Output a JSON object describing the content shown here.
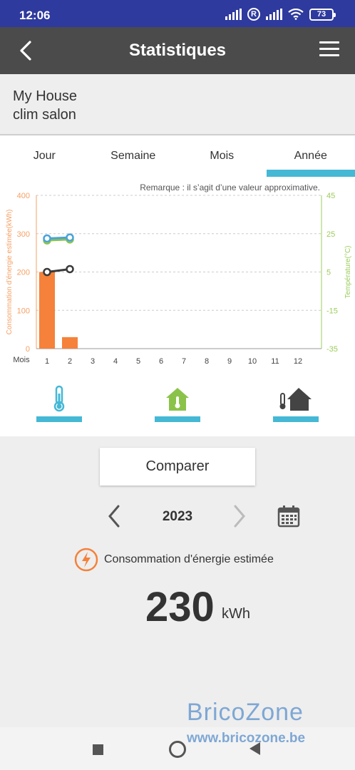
{
  "status": {
    "time": "12:06",
    "battery": "73",
    "roaming": "R"
  },
  "appbar": {
    "title": "Statistiques"
  },
  "device": {
    "home": "My House",
    "name": "clim salon"
  },
  "tabs": [
    {
      "label": "Jour"
    },
    {
      "label": "Semaine"
    },
    {
      "label": "Mois"
    },
    {
      "label": "Année",
      "active": true
    }
  ],
  "chart_data": {
    "type": "bar",
    "note": "Remarque : il s’agit d’une valeur approximative.",
    "xlabel": "Mois",
    "ylabel": "Consommation d’énergie estimée(kWh)",
    "y2label": "Température(°C)",
    "categories": [
      "1",
      "2",
      "3",
      "4",
      "5",
      "6",
      "7",
      "8",
      "9",
      "10",
      "11",
      "12"
    ],
    "ylim": [
      0,
      400
    ],
    "yticks": [
      "0",
      "100",
      "200",
      "300",
      "400"
    ],
    "y2lim": [
      -35,
      45
    ],
    "y2ticks": [
      "-35",
      "-15",
      "5",
      "25",
      "45"
    ],
    "series": [
      {
        "kind": "bar",
        "values": [
          200,
          30
        ],
        "color": "#f5813a"
      },
      {
        "kind": "line",
        "axis": "y2",
        "values": [
          21.5,
          22
        ],
        "color": "#8bc34a"
      },
      {
        "kind": "line",
        "axis": "y2",
        "values": [
          22.5,
          23
        ],
        "color": "#4aa3d9"
      },
      {
        "kind": "line",
        "axis": "y2",
        "values": [
          5,
          6.5
        ],
        "color": "#3a3a3a"
      }
    ],
    "colors": {
      "axis_left": "#f5a064",
      "axis_right": "#9ccc5c",
      "grid": "#cccccc"
    }
  },
  "toggles": [
    {
      "icon": "thermometer-icon"
    },
    {
      "icon": "house-temperature-icon"
    },
    {
      "icon": "thermometer-house-icon"
    }
  ],
  "compare_label": "Comparer",
  "year": "2023",
  "energy": {
    "label": "Consommation d'énergie estimée",
    "value": "230",
    "unit": "kWh"
  },
  "watermark": {
    "brand": "BricoZone",
    "url": "www.bricozone.be"
  },
  "accent": "#45b8d6"
}
